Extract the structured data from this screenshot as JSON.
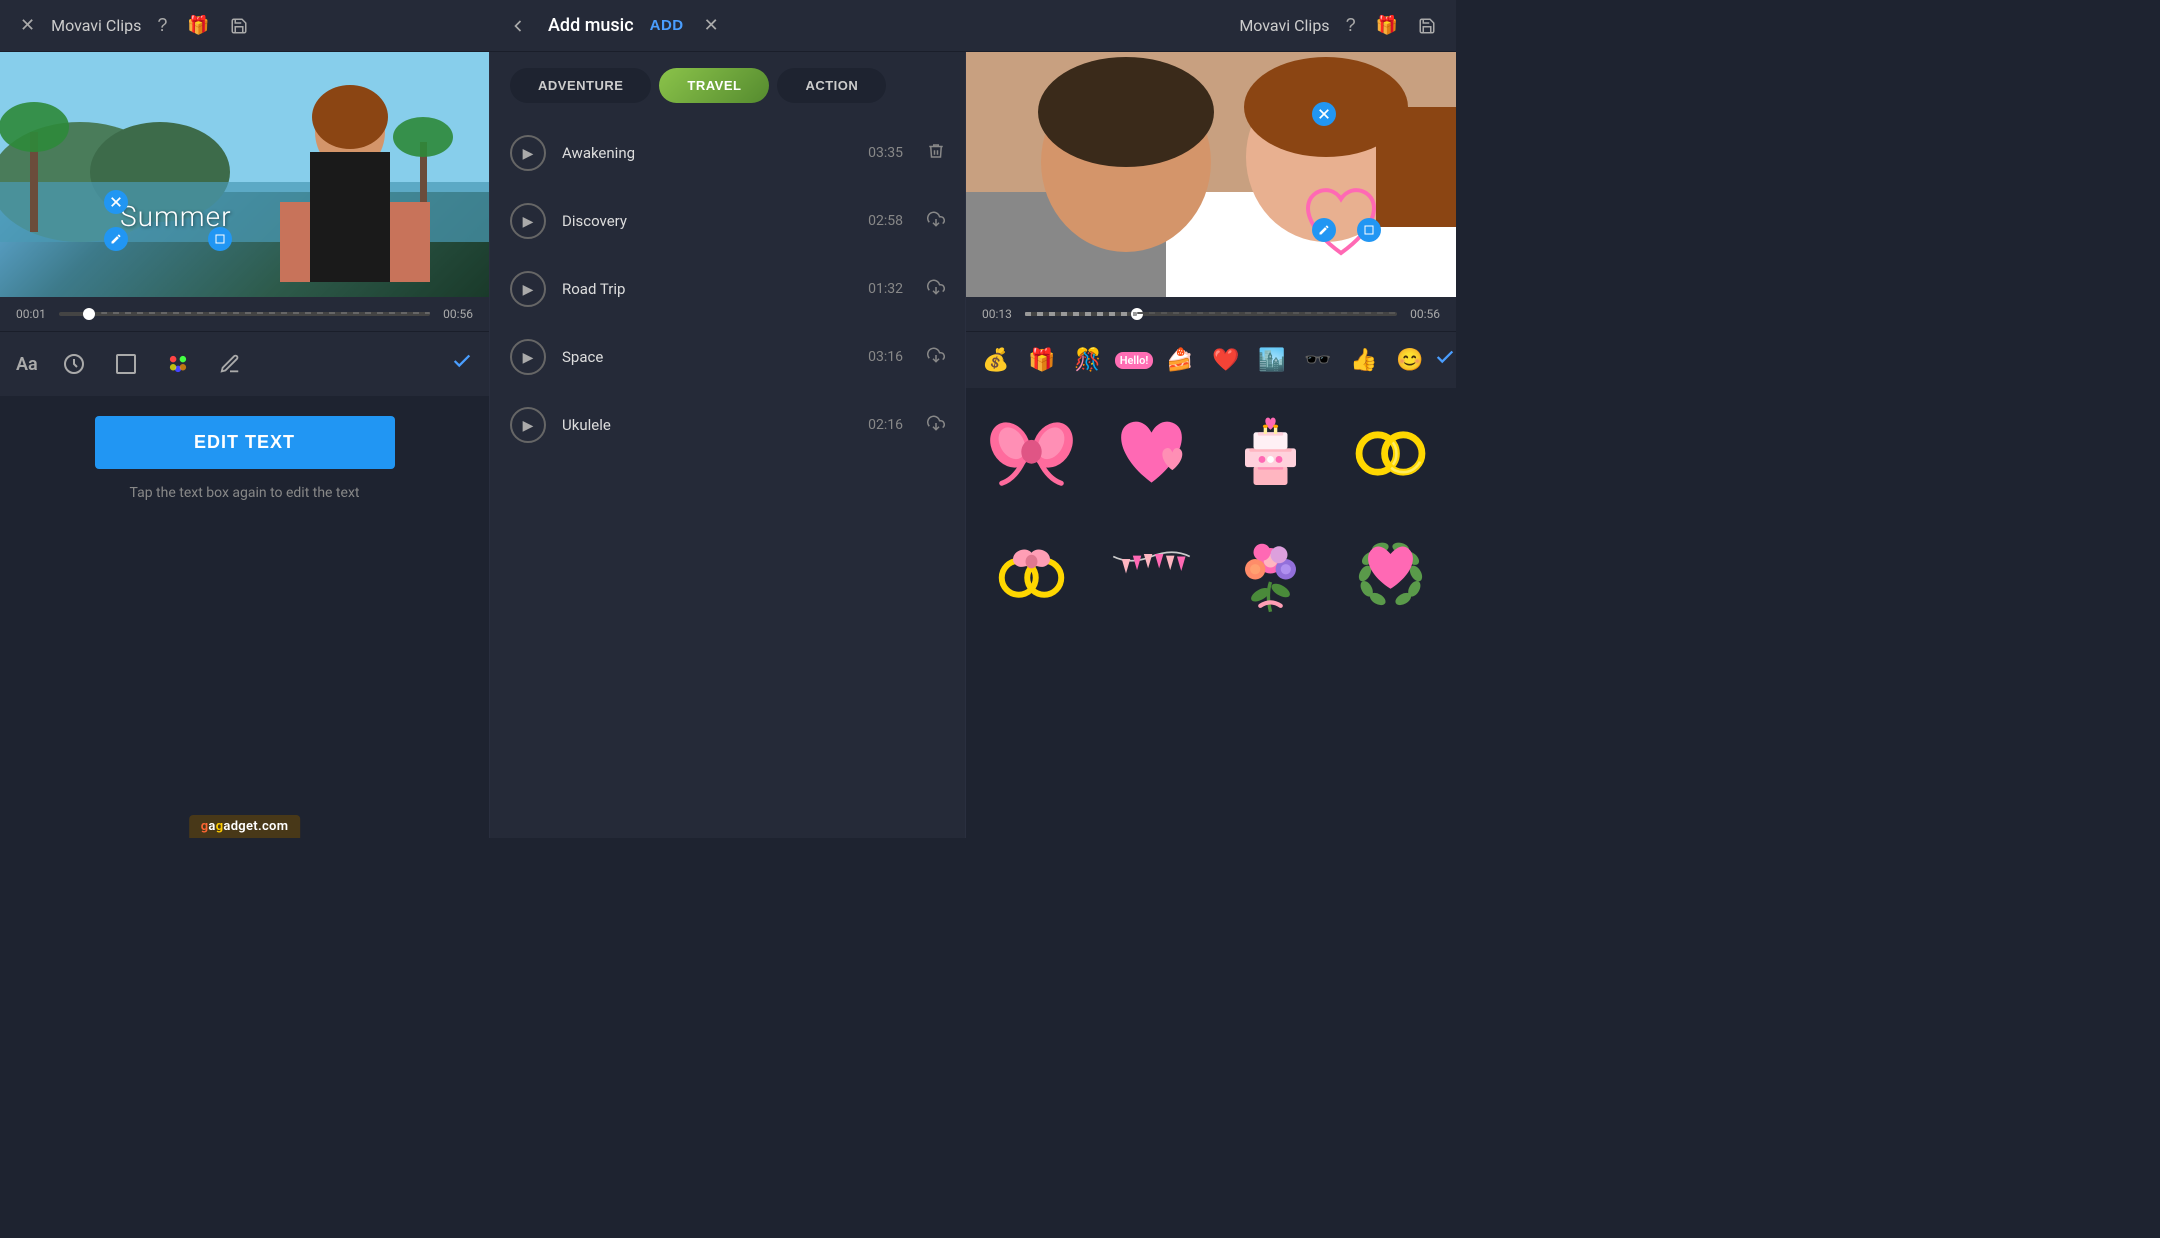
{
  "header": {
    "left": {
      "close_label": "✕",
      "app_title": "Movavi Clips",
      "help_icon": "?",
      "gift_icon": "🎁",
      "save_icon": "💾"
    },
    "center": {
      "back_icon": "←",
      "title": "Add music",
      "add_label": "ADD",
      "close_icon": "✕"
    },
    "right": {
      "app_title": "Movavi Clips",
      "help_icon": "?",
      "gift_icon": "🎁",
      "save_icon": "💾"
    }
  },
  "music_panel": {
    "categories": [
      {
        "id": "adventure",
        "label": "ADVENTURE",
        "active": false
      },
      {
        "id": "travel",
        "label": "TRAVEL",
        "active": true
      },
      {
        "id": "action",
        "label": "ACTION",
        "active": false
      }
    ],
    "tracks": [
      {
        "name": "Awakening",
        "duration": "03:35",
        "downloaded": true
      },
      {
        "name": "Discovery",
        "duration": "02:58",
        "downloaded": false
      },
      {
        "name": "Road Trip",
        "duration": "01:32",
        "downloaded": false
      },
      {
        "name": "Space",
        "duration": "03:16",
        "downloaded": false
      },
      {
        "name": "Ukulele",
        "duration": "02:16",
        "downloaded": false
      }
    ]
  },
  "left_panel": {
    "text_overlay": "Summer",
    "timeline": {
      "start": "00:01",
      "end": "00:56"
    },
    "toolbar": {
      "aa_label": "Aa",
      "clock_icon": "clock",
      "frame_icon": "frame",
      "palette_icon": "palette",
      "pen_icon": "pen",
      "check_icon": "✓"
    },
    "edit_text_btn": "EDIT TEXT",
    "hint": "Tap the text box again to edit the text"
  },
  "right_panel": {
    "timeline": {
      "start": "00:13",
      "end": "00:56"
    },
    "sticker_toolbar": [
      {
        "icon": "💰",
        "name": "money-sticker"
      },
      {
        "icon": "🎁",
        "name": "gift-sticker"
      },
      {
        "icon": "🎊",
        "name": "party-sticker"
      },
      {
        "icon": "💬",
        "name": "hello-sticker"
      },
      {
        "icon": "🍰",
        "name": "cake-small-sticker"
      },
      {
        "icon": "❤️",
        "name": "heart-sticker"
      },
      {
        "icon": "🏙️",
        "name": "city-sticker"
      },
      {
        "icon": "🕶️",
        "name": "sunglasses-sticker"
      },
      {
        "icon": "👍",
        "name": "thumbs-sticker"
      },
      {
        "icon": "😊",
        "name": "emoji-sticker"
      }
    ],
    "sticker_grid": [
      {
        "emoji": "🎀",
        "name": "ribbon-bow"
      },
      {
        "emoji": "💗",
        "name": "heart-pink"
      },
      {
        "emoji": "🎂",
        "name": "wedding-cake"
      },
      {
        "emoji": "💍",
        "name": "wedding-rings-gold"
      },
      {
        "emoji": "💍",
        "name": "rings-bouquet"
      },
      {
        "emoji": "🎏",
        "name": "bunting-flags"
      },
      {
        "emoji": "💐",
        "name": "flower-bouquet"
      },
      {
        "emoji": "💚",
        "name": "heart-wreath"
      }
    ]
  },
  "watermark": {
    "text": "gagadget.com",
    "g_color": "#ff6633",
    "a_color": "#ffcc00"
  }
}
